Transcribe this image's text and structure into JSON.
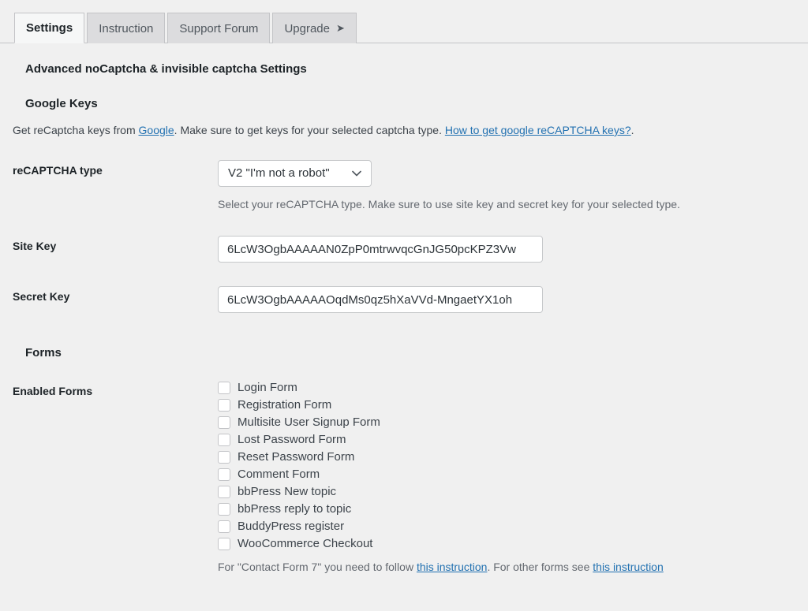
{
  "tabs": [
    {
      "label": "Settings",
      "active": true,
      "arrow": ""
    },
    {
      "label": "Instruction",
      "active": false,
      "arrow": ""
    },
    {
      "label": "Support Forum",
      "active": false,
      "arrow": ""
    },
    {
      "label": "Upgrade",
      "active": false,
      "arrow": "➤"
    }
  ],
  "page": {
    "title": "Advanced noCaptcha & invisible captcha Settings",
    "google_keys_heading": "Google Keys",
    "intro": {
      "part1": "Get reCaptcha keys from ",
      "google_link": "Google",
      "part2": ". Make sure to get keys for your selected captcha type. ",
      "howto_link": "How to get google reCAPTCHA keys?",
      "part3": "."
    },
    "forms_heading": "Forms"
  },
  "fields": {
    "recaptcha_type": {
      "label": "reCAPTCHA type",
      "value": "V2 \"I'm not a robot\"",
      "chevron": "⌄",
      "description": "Select your reCAPTCHA type. Make sure to use site key and secret key for your selected type."
    },
    "site_key": {
      "label": "Site Key",
      "value": "6LcW3OgbAAAAAN0ZpP0mtrwvqcGnJG50pcKPZ3Vw",
      "placeholder": ""
    },
    "secret_key": {
      "label": "Secret Key",
      "value": "6LcW3OgbAAAAAOqdMs0qz5hXaVVd-MngaetYX1oh",
      "placeholder": ""
    },
    "enabled_forms": {
      "label": "Enabled Forms",
      "options": [
        {
          "label": "Login Form",
          "checked": false
        },
        {
          "label": "Registration Form",
          "checked": false
        },
        {
          "label": "Multisite User Signup Form",
          "checked": false
        },
        {
          "label": "Lost Password Form",
          "checked": false
        },
        {
          "label": "Reset Password Form",
          "checked": false
        },
        {
          "label": "Comment Form",
          "checked": false
        },
        {
          "label": "bbPress New topic",
          "checked": false
        },
        {
          "label": "bbPress reply to topic",
          "checked": false
        },
        {
          "label": "BuddyPress register",
          "checked": false
        },
        {
          "label": "WooCommerce Checkout",
          "checked": false
        }
      ],
      "note": {
        "part1": "For \"Contact Form 7\" you need to follow ",
        "link1": "this instruction",
        "part2": ". For other forms see ",
        "link2": "this instruction"
      }
    }
  },
  "colors": {
    "link": "#2271b1",
    "background": "#f0f0f0",
    "tab_inactive": "#dcdcde",
    "tab_active": "#f6f7f7",
    "border": "#c3c4c7",
    "text": "#3c434a",
    "muted": "#646970"
  }
}
